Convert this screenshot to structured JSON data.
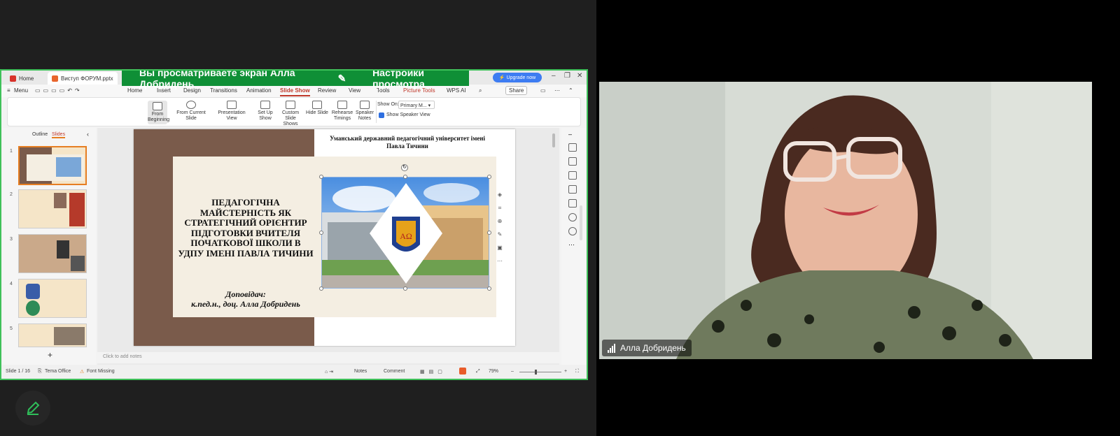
{
  "browser_tabs": [
    {
      "label": "Home",
      "icon": "wps-icon"
    },
    {
      "label": "Виступ ФОРУМ.pptx",
      "icon": "pptx-icon"
    }
  ],
  "share_banner": {
    "text": "Вы просматриваете экран Алла Добридень",
    "settings_label": "Настройки просмотра"
  },
  "upgrade_label": "Upgrade now",
  "menu": {
    "menu_label": "Menu",
    "tabs": [
      "Home",
      "Insert",
      "Design",
      "Transitions",
      "Animation",
      "Slide Show",
      "Review",
      "View",
      "Tools",
      "Picture Tools",
      "WPS AI"
    ],
    "active_tab": "Slide Show",
    "share_label": "Share"
  },
  "ribbon": {
    "from_beginning": "From Beginning",
    "from_current": "From Current Slide",
    "presentation_view": "Presentation View",
    "set_up_show": "Set Up Show",
    "custom_slide_shows": "Custom Slide Shows",
    "hide_slide": "Hide Slide",
    "rehearse_timings": "Rehearse Timings",
    "speaker_notes": "Speaker Notes",
    "show_on_label": "Show On:",
    "show_on_value": "Primary M...",
    "show_speaker_view": "Show Speaker View"
  },
  "panel": {
    "outline_tab": "Outline",
    "slides_tab": "Slides",
    "slide_numbers": [
      "1",
      "2",
      "3",
      "4",
      "5"
    ]
  },
  "slide": {
    "university": "Уманський державний педагогічний університет імені Павла Тичини",
    "title": "ПЕДАГОГІЧНА МАЙСТЕРНІСТЬ ЯК СТРАТЕГІЧНИЙ ОРІЄНТИР ПІДГОТОВКИ ВЧИТЕЛЯ ПОЧАТКОВОЇ ШКОЛИ В УДПУ ІМЕНІ ПАВЛА ТИЧИНИ",
    "speaker_label": "Доповідач:",
    "speaker_name": "к.пед.н., доц. Алла Добридень"
  },
  "notes_placeholder": "Click to add notes",
  "status": {
    "slide_counter": "Slide 1 / 16",
    "theme": "Tema Office",
    "font_missing": "Font Missing",
    "notes": "Notes",
    "comment": "Comment",
    "zoom": "79%"
  },
  "participant": {
    "name": "Алла Добридень"
  },
  "colors": {
    "share_border": "#3fc15a",
    "banner_bg": "#0f8f36",
    "slide_brown": "#7a5b4b",
    "accent": "#c0392b"
  }
}
